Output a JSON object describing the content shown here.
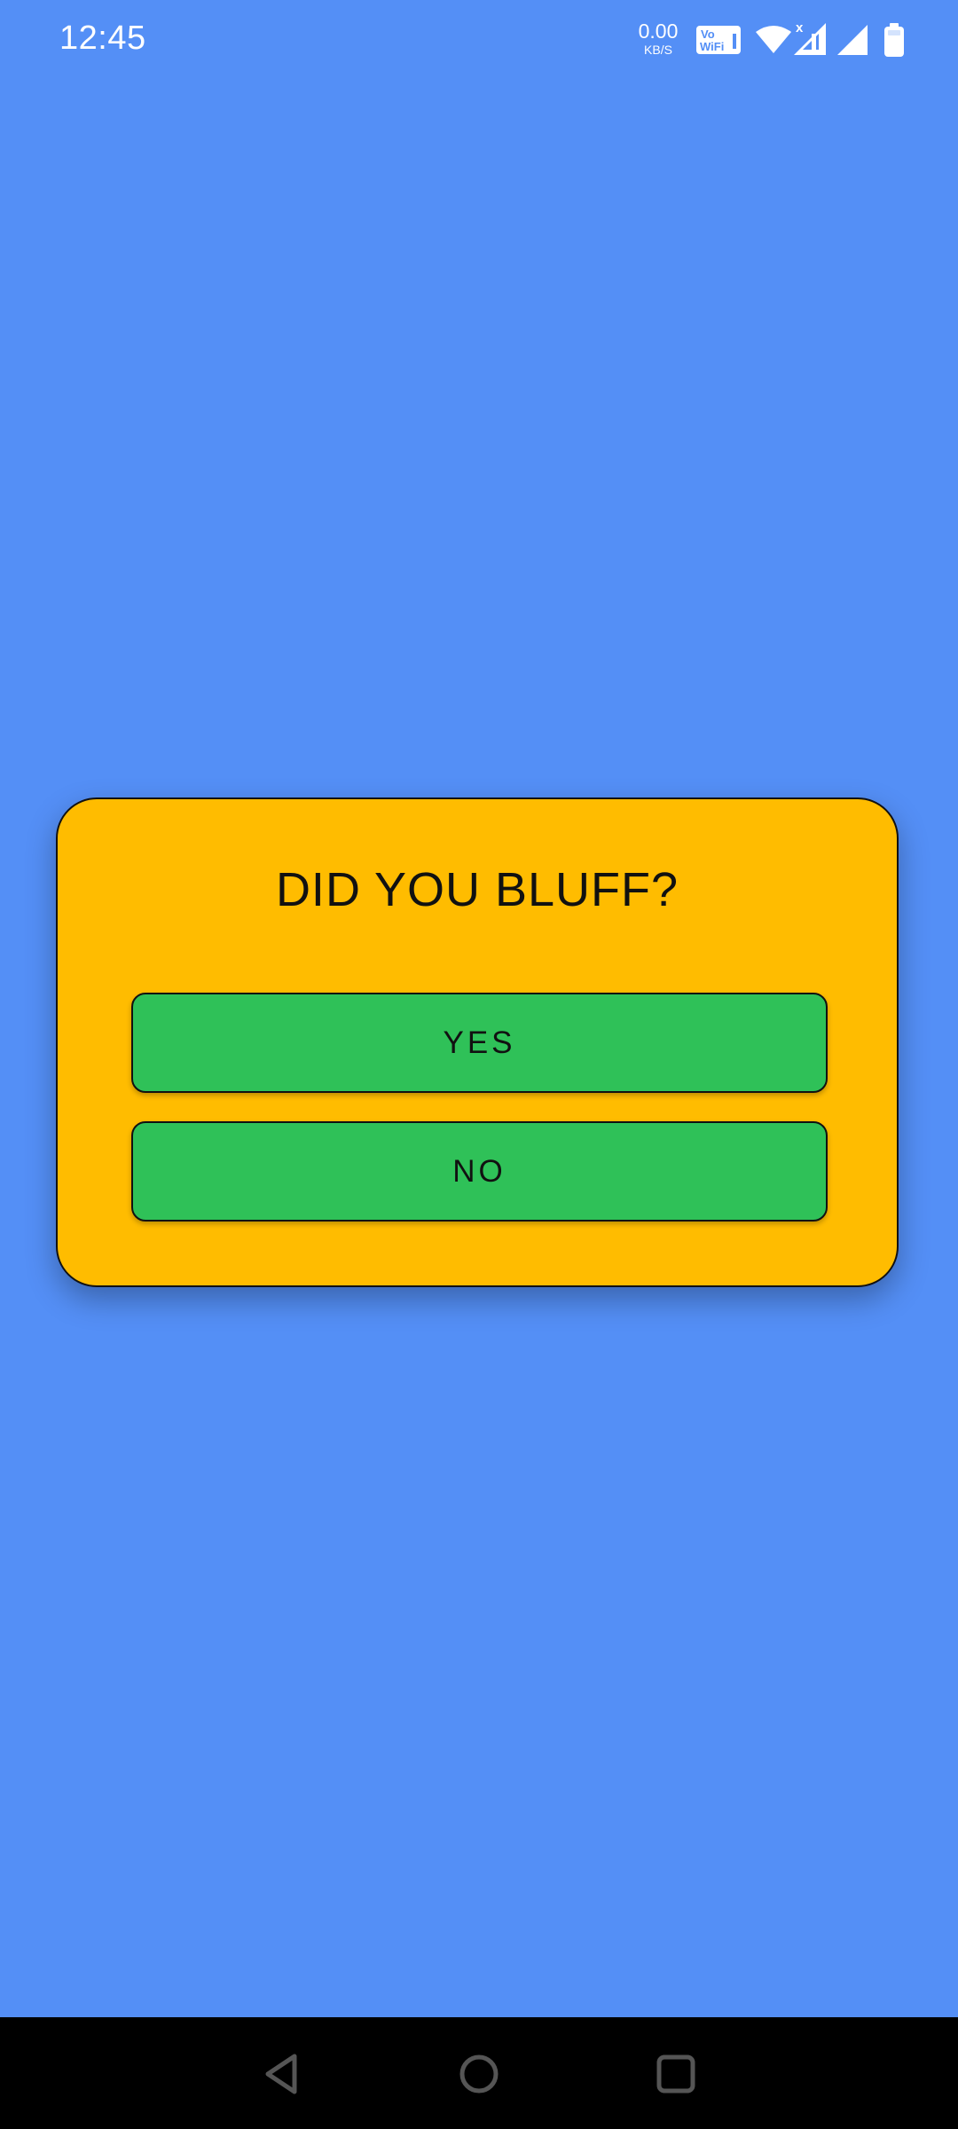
{
  "status_bar": {
    "time": "12:45",
    "net_speed_value": "0.00",
    "net_speed_unit": "KB/S",
    "vowifi_line1": "Vo",
    "vowifi_line2": "WiFi",
    "icons": [
      "vowifi-icon",
      "wifi-icon",
      "signal-icon",
      "signal-icon",
      "battery-icon"
    ]
  },
  "dialog": {
    "title": "DID YOU BLUFF?",
    "yes_label": "YES",
    "no_label": "NO"
  },
  "nav_bar": {
    "icons": [
      "back-icon",
      "home-icon",
      "recents-icon"
    ]
  },
  "colors": {
    "background": "#548ff6",
    "dialog": "#ffbc00",
    "button": "#2fc158",
    "nav_bar": "#000000"
  }
}
